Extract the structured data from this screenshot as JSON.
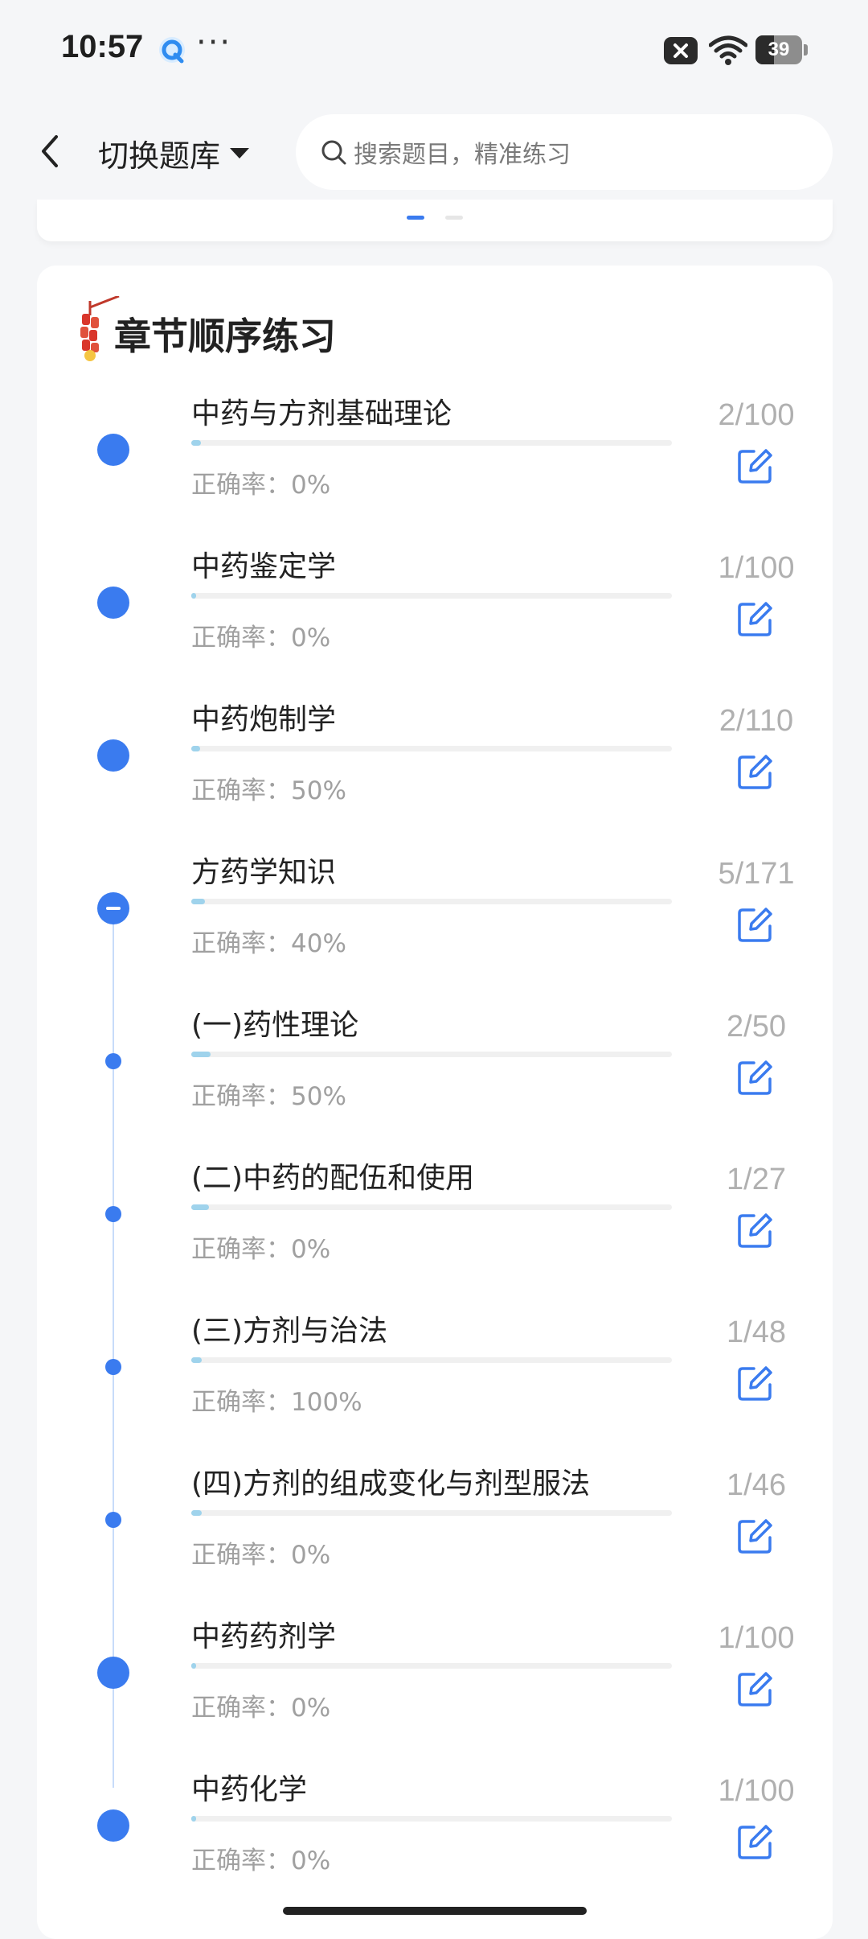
{
  "status_bar": {
    "time": "10:57",
    "dots": "···",
    "battery_level": "39",
    "battery_fraction": 0.39
  },
  "header": {
    "switch_label": "切换题库",
    "search_placeholder": "搜索题目，精准练习"
  },
  "pager": {
    "active_index": 0,
    "pages": 2
  },
  "section": {
    "title": "章节顺序练习",
    "accuracy_label": "正确率：",
    "chapters": [
      {
        "title": "中药与方剂基础理论",
        "accuracy": "0%",
        "count": "2/100",
        "progress": 0.02,
        "node": "big"
      },
      {
        "title": "中药鉴定学",
        "accuracy": "0%",
        "count": "1/100",
        "progress": 0.01,
        "node": "big"
      },
      {
        "title": "中药炮制学",
        "accuracy": "50%",
        "count": "2/110",
        "progress": 0.018,
        "node": "big"
      },
      {
        "title": "方药学知识",
        "accuracy": "40%",
        "count": "5/171",
        "progress": 0.029,
        "node": "collapse"
      },
      {
        "title": "(一)药性理论",
        "accuracy": "50%",
        "count": "2/50",
        "progress": 0.04,
        "node": "small"
      },
      {
        "title": "(二)中药的配伍和使用",
        "accuracy": "0%",
        "count": "1/27",
        "progress": 0.037,
        "node": "small"
      },
      {
        "title": "(三)方剂与治法",
        "accuracy": "100%",
        "count": "1/48",
        "progress": 0.021,
        "node": "small"
      },
      {
        "title": "(四)方剂的组成变化与剂型服法",
        "accuracy": "0%",
        "count": "1/46",
        "progress": 0.022,
        "node": "small"
      },
      {
        "title": "中药药剂学",
        "accuracy": "0%",
        "count": "1/100",
        "progress": 0.01,
        "node": "big"
      },
      {
        "title": "中药化学",
        "accuracy": "0%",
        "count": "1/100",
        "progress": 0.01,
        "node": "big"
      }
    ]
  },
  "colors": {
    "accent": "#3a7bef",
    "progress": "#9fd3ec",
    "muted_text": "#a0a0a0"
  }
}
